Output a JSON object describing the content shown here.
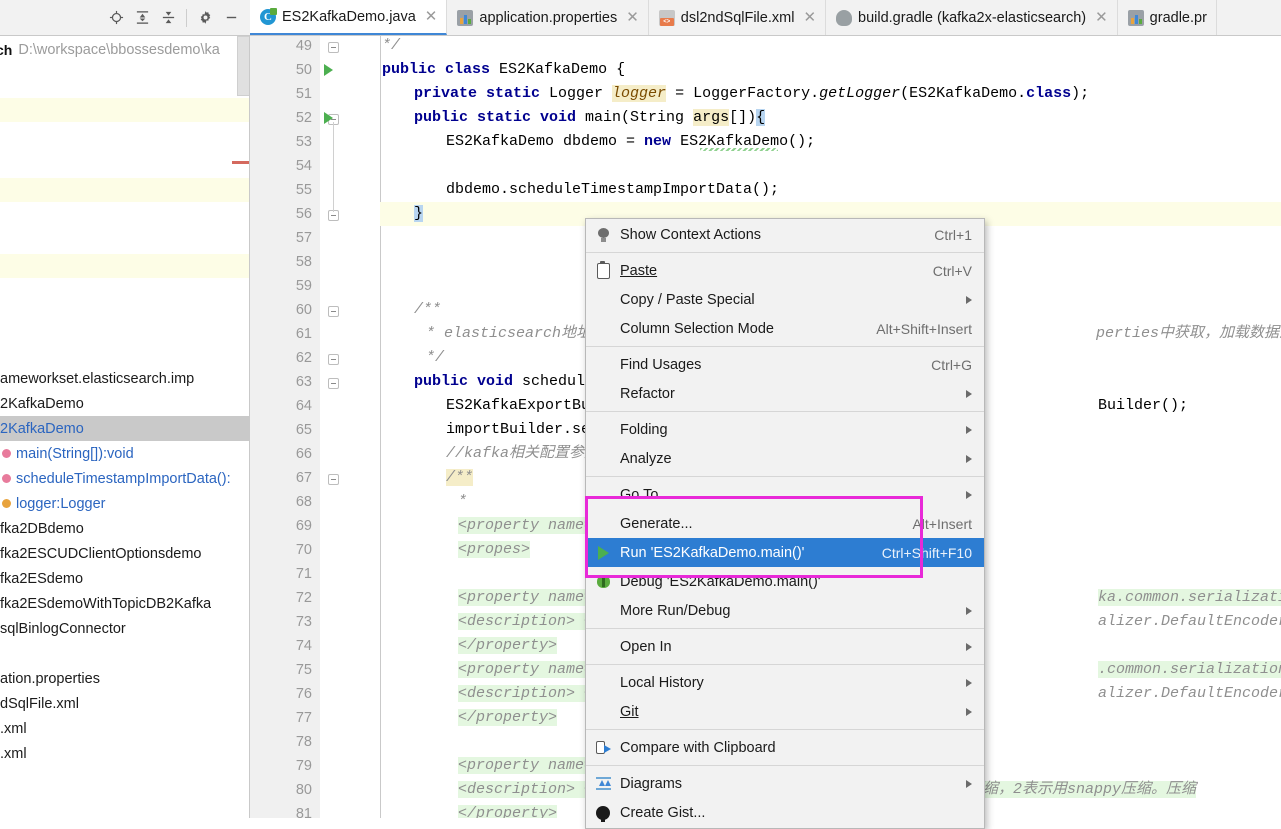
{
  "left_toolbar": {
    "icons": [
      {
        "name": "locate-icon",
        "glyph": "⊕"
      },
      {
        "name": "expand-all-icon",
        "glyph": "⩝"
      },
      {
        "name": "collapse-all-icon",
        "glyph": "⩞"
      },
      {
        "name": "settings-gear-icon",
        "glyph": "⚙"
      },
      {
        "name": "hide-panel-icon",
        "glyph": "−"
      }
    ]
  },
  "search": {
    "label": "ch",
    "path": "D:\\workspace\\bbossesdemo\\ka"
  },
  "tabs": [
    {
      "label": "ES2KafkaDemo.java",
      "icon": "java-class-icon",
      "active": true,
      "closable": true
    },
    {
      "label": "application.properties",
      "icon": "properties-file-icon",
      "active": false,
      "closable": true
    },
    {
      "label": "dsl2ndSqlFile.xml",
      "icon": "xml-file-icon",
      "active": false,
      "closable": true
    },
    {
      "label": "build.gradle (kafka2x-elasticsearch)",
      "icon": "gradle-file-icon",
      "active": false,
      "closable": true
    },
    {
      "label": "gradle.pr",
      "icon": "properties-file-icon",
      "active": false,
      "closable": false
    }
  ],
  "structure_tree": [
    {
      "label": "ameworkset.elasticsearch.imp",
      "color": "dark",
      "bullet": "none",
      "selected": false
    },
    {
      "label": "2KafkaDemo",
      "color": "dark",
      "bullet": "none",
      "selected": false
    },
    {
      "label": "2KafkaDemo",
      "color": "blue",
      "bullet": "none",
      "selected": true
    },
    {
      "label": "main(String[]):void",
      "color": "blue",
      "bullet": "pink",
      "selected": false
    },
    {
      "label": "scheduleTimestampImportData():",
      "color": "blue",
      "bullet": "pink",
      "selected": false
    },
    {
      "label": "logger:Logger",
      "color": "blue",
      "bullet": "orange",
      "selected": false
    },
    {
      "label": "fka2DBdemo",
      "color": "dark",
      "bullet": "none",
      "selected": false
    },
    {
      "label": "fka2ESCUDClientOptionsdemo",
      "color": "dark",
      "bullet": "none",
      "selected": false
    },
    {
      "label": "fka2ESdemo",
      "color": "dark",
      "bullet": "none",
      "selected": false
    },
    {
      "label": "fka2ESdemoWithTopicDB2Kafka",
      "color": "dark",
      "bullet": "none",
      "selected": false
    },
    {
      "label": "sqlBinlogConnector",
      "color": "dark",
      "bullet": "none",
      "selected": false
    },
    {
      "label": "",
      "color": "blue",
      "bullet": "none",
      "selected": false
    },
    {
      "label": "ation.properties",
      "color": "dark",
      "bullet": "none",
      "selected": false
    },
    {
      "label": "dSqlFile.xml",
      "color": "dark",
      "bullet": "none",
      "selected": false
    },
    {
      "label": ".xml",
      "color": "dark",
      "bullet": "none",
      "selected": false
    },
    {
      "label": ".xml",
      "color": "dark",
      "bullet": "none",
      "selected": false
    }
  ],
  "editor": {
    "file": "ES2KafkaDemo.java",
    "first_line": 49,
    "last_line": 81,
    "lines": [
      {
        "n": 49,
        "text": "*/"
      },
      {
        "n": 50,
        "text": "public class ES2KafkaDemo {"
      },
      {
        "n": 51,
        "text": "private static Logger logger = LoggerFactory.getLogger(ES2KafkaDemo.class);"
      },
      {
        "n": 52,
        "text": "public static void main(String args[]){"
      },
      {
        "n": 53,
        "text": "ES2KafkaDemo dbdemo = new ES2KafkaDemo();"
      },
      {
        "n": 54,
        "text": ""
      },
      {
        "n": 55,
        "text": "dbdemo.scheduleTimestampImportData();"
      },
      {
        "n": 56,
        "text": "}"
      },
      {
        "n": 57,
        "text": ""
      },
      {
        "n": 58,
        "text": ""
      },
      {
        "n": 59,
        "text": ""
      },
      {
        "n": 60,
        "text": "/**"
      },
      {
        "n": 61,
        "text": "* elasticsearch地址和              perties中获取，加载数据源配置和es"
      },
      {
        "n": 62,
        "text": "*/"
      },
      {
        "n": 63,
        "text": "public void scheduleT"
      },
      {
        "n": 64,
        "text": "ES2KafkaExportBui                Builder();"
      },
      {
        "n": 65,
        "text": "importBuilder.set"
      },
      {
        "n": 66,
        "text": "//kafka相关配置参数"
      },
      {
        "n": 67,
        "text": "/**"
      },
      {
        "n": 68,
        "text": "*"
      },
      {
        "n": 69,
        "text": "<property name=\""
      },
      {
        "n": 70,
        "text": "<propes>"
      },
      {
        "n": 71,
        "text": ""
      },
      {
        "n": 72,
        "text": "<property name=\"                    ka.common.serialization.String"
      },
      {
        "n": 73,
        "text": "<description> <!                    alizer.DefaultEncoder,即byte[]"
      },
      {
        "n": 74,
        "text": "</property>"
      },
      {
        "n": 75,
        "text": "<property name=\"                    .common.serialization.LongSeri"
      },
      {
        "n": 76,
        "text": "<description> <!                    alizer.DefaultEncoder,即byte[]"
      },
      {
        "n": 77,
        "text": "</property>"
      },
      {
        "n": 78,
        "text": ""
      },
      {
        "n": 79,
        "text": "<property name=\"compression.type\" value=\"gzip\">"
      },
      {
        "n": 80,
        "text": "<description> <![CDATA[ 是否压缩，默认0表示不压缩，1表示用gzip压缩，2表示用snappy压缩。压缩"
      },
      {
        "n": 81,
        "text": "</property>"
      }
    ],
    "code_fragments": {
      "l49_comment": "*/",
      "l50_kw1": "public",
      "l50_kw2": "class",
      "l50_name": " ES2KafkaDemo {",
      "l51_kw": "private static",
      "l51_type": " Logger ",
      "l51_field": "logger",
      "l51_rest": " = LoggerFactory.",
      "l51_method": "getLogger",
      "l51_tail": "(ES2KafkaDemo.",
      "l51_class_kw": "class",
      "l51_end": ");",
      "l52_kw": "public static void",
      "l52_main": " main(String ",
      "l52_args": "args",
      "l52_br": "[])",
      "l52_brace": "{",
      "l53": "ES2KafkaDemo dbdemo = ",
      "l53_new": "new",
      "l53_tail": " ES2KafkaDemo();",
      "l55": "dbdemo.scheduleTimestampImportData();",
      "l56": "}",
      "l60": "/**",
      "l61a": "* elasticsearch地址和",
      "l61b": "perties中获取，加载数据源配置和es",
      "l62": "*/",
      "l63_kw": "public void",
      "l63_name": " scheduleT",
      "l64": "ES2KafkaExportBui",
      "l64b": "Builder();",
      "l65": "importBuilder.set",
      "l66": "//kafka相关配置参数",
      "l67": "/**",
      "l68": "*",
      "l69": "<property name=\"",
      "l70": "<propes>",
      "l72": "<property name=\"",
      "l72b": "ka.common.serialization.String",
      "l73": "<description> <!",
      "l73b": "alizer.DefaultEncoder,即byte[]",
      "l74": "</property>",
      "l75": "<property name=\"",
      "l75b": ".common.serialization.LongSeri",
      "l76": "<description> <!",
      "l76b": "alizer.DefaultEncoder,即byte[]",
      "l77": "</property>",
      "l79": "<property name=\"compression.type\" value=\"gzip\">",
      "l80": "<description> <![CDATA[ 是否压缩，默认0表示不压缩，1表示用gzip压缩，2表示用snappy压缩。压缩",
      "l81": "</property>"
    }
  },
  "context_menu": {
    "highlight_color": "#2d7dd2",
    "callout_color": "#e829d8",
    "items": [
      {
        "label": "Show Context Actions",
        "shortcut": "Ctrl+1",
        "icon": "lightbulb-icon",
        "submenu": false,
        "highlighted": false,
        "mnemonic": "",
        "sep_after": true
      },
      {
        "label": "Paste",
        "shortcut": "Ctrl+V",
        "icon": "clipboard-icon",
        "submenu": false,
        "highlighted": false,
        "mnemonic": "P",
        "sep_after": false
      },
      {
        "label": "Copy / Paste Special",
        "shortcut": "",
        "icon": "none",
        "submenu": true,
        "highlighted": false,
        "mnemonic": "",
        "sep_after": false
      },
      {
        "label": "Column Selection Mode",
        "shortcut": "Alt+Shift+Insert",
        "icon": "none",
        "submenu": false,
        "highlighted": false,
        "mnemonic": "M",
        "sep_after": true
      },
      {
        "label": "Find Usages",
        "shortcut": "Ctrl+G",
        "icon": "none",
        "submenu": false,
        "highlighted": false,
        "mnemonic": "U",
        "sep_after": false
      },
      {
        "label": "Refactor",
        "shortcut": "",
        "icon": "none",
        "submenu": true,
        "highlighted": false,
        "mnemonic": "R",
        "sep_after": true
      },
      {
        "label": "Folding",
        "shortcut": "",
        "icon": "none",
        "submenu": true,
        "highlighted": false,
        "mnemonic": "",
        "sep_after": false
      },
      {
        "label": "Analyze",
        "shortcut": "",
        "icon": "none",
        "submenu": true,
        "highlighted": false,
        "mnemonic": "z",
        "sep_after": true
      },
      {
        "label": "Go To",
        "shortcut": "",
        "icon": "none",
        "submenu": true,
        "highlighted": false,
        "mnemonic": "",
        "sep_after": false
      },
      {
        "label": "Generate...",
        "shortcut": "Alt+Insert",
        "icon": "none",
        "submenu": false,
        "highlighted": false,
        "mnemonic": "",
        "sep_after": false
      },
      {
        "label": "Run 'ES2KafkaDemo.main()'",
        "shortcut": "Ctrl+Shift+F10",
        "icon": "run-play-icon",
        "submenu": false,
        "highlighted": true,
        "mnemonic": "u",
        "sep_after": false
      },
      {
        "label": "Debug 'ES2KafkaDemo.main()'",
        "shortcut": "",
        "icon": "debug-bug-icon",
        "submenu": false,
        "highlighted": false,
        "mnemonic": "D",
        "sep_after": false
      },
      {
        "label": "More Run/Debug",
        "shortcut": "",
        "icon": "none",
        "submenu": true,
        "highlighted": false,
        "mnemonic": "",
        "sep_after": true
      },
      {
        "label": "Open In",
        "shortcut": "",
        "icon": "none",
        "submenu": true,
        "highlighted": false,
        "mnemonic": "",
        "sep_after": true
      },
      {
        "label": "Local History",
        "shortcut": "",
        "icon": "none",
        "submenu": true,
        "highlighted": false,
        "mnemonic": "H",
        "sep_after": false
      },
      {
        "label": "Git",
        "shortcut": "",
        "icon": "none",
        "submenu": true,
        "highlighted": false,
        "mnemonic": "G",
        "sep_after": true
      },
      {
        "label": "Compare with Clipboard",
        "shortcut": "",
        "icon": "compare-icon",
        "submenu": false,
        "highlighted": false,
        "mnemonic": "b",
        "sep_after": true
      },
      {
        "label": "Diagrams",
        "shortcut": "",
        "icon": "diagrams-icon",
        "submenu": true,
        "highlighted": false,
        "mnemonic": "",
        "sep_after": false
      },
      {
        "label": "Create Gist...",
        "shortcut": "",
        "icon": "github-icon",
        "submenu": false,
        "highlighted": false,
        "mnemonic": "",
        "sep_after": false
      }
    ]
  }
}
